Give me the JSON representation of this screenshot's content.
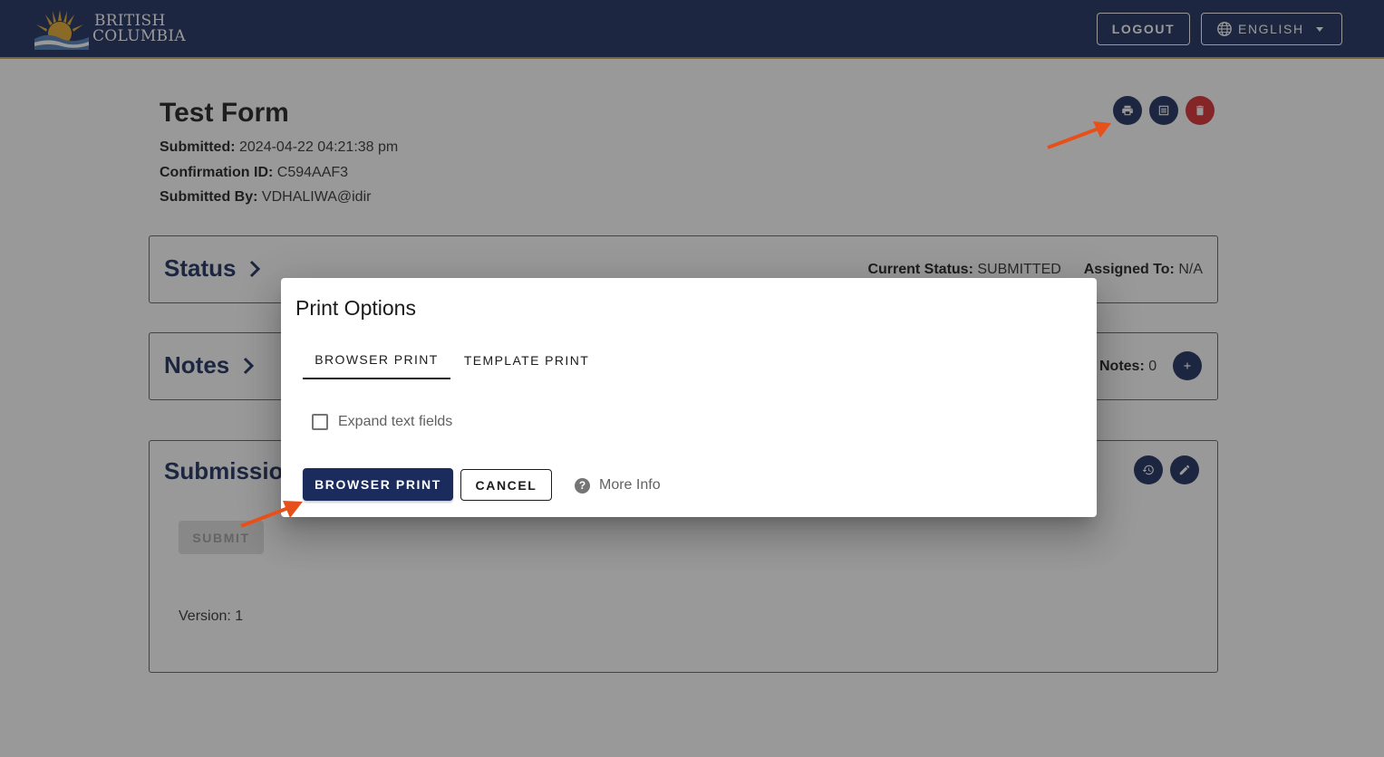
{
  "header": {
    "logo_line1": "BRITISH",
    "logo_line2": "COLUMBIA",
    "logout_label": "LOGOUT",
    "language_label": "ENGLISH",
    "bg_color": "#1a2b5c",
    "accent_color": "#c2a14a"
  },
  "form": {
    "title": "Test Form",
    "submitted_label": "Submitted:",
    "submitted_value": "2024-04-22 04:21:38 pm",
    "confirmation_label": "Confirmation ID:",
    "confirmation_value": "C594AAF3",
    "submitted_by_label": "Submitted By:",
    "submitted_by_value": "VDHALIWA@idir"
  },
  "status_card": {
    "title": "Status",
    "current_status_label": "Current Status:",
    "current_status_value": "SUBMITTED",
    "assigned_label": "Assigned To:",
    "assigned_value": "N/A"
  },
  "notes_card": {
    "title": "Notes",
    "notes_label": "Notes:",
    "notes_value": "0"
  },
  "submission_card": {
    "title": "Submission",
    "submit_label": "SUBMIT",
    "version_text": "Version: 1"
  },
  "dialog": {
    "title": "Print Options",
    "tabs": [
      "BROWSER PRINT",
      "TEMPLATE PRINT"
    ],
    "active_tab": 0,
    "expand_label": "Expand text fields",
    "expand_checked": false,
    "browser_print_label": "BROWSER PRINT",
    "cancel_label": "CANCEL",
    "more_info_label": "More Info"
  },
  "icons": [
    "globe-icon",
    "print-icon",
    "list-icon",
    "delete-icon",
    "chevron-right-icon",
    "add-icon",
    "history-icon",
    "edit-icon",
    "help-icon"
  ],
  "annotation_color": "#e8501a"
}
